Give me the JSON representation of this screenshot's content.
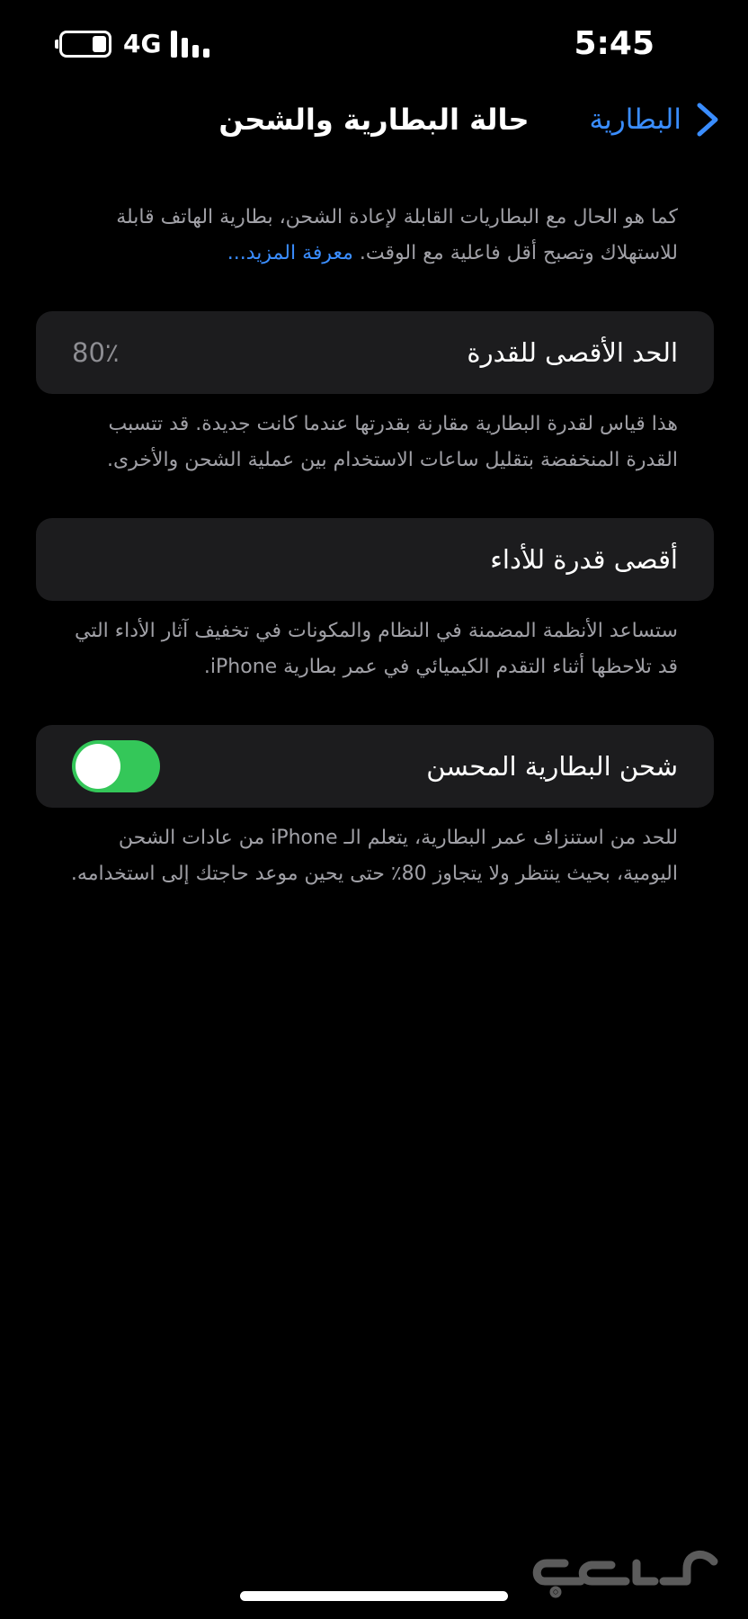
{
  "status_bar": {
    "network": "4G",
    "time": "5:45"
  },
  "nav": {
    "back_label": "البطارية",
    "title": "حالة البطارية والشحن"
  },
  "intro": {
    "text": "كما هو الحال مع البطاريات القابلة لإعادة الشحن، بطارية الهاتف قابلة للاستهلاك وتصبح أقل فاعلية مع الوقت. ",
    "link": "معرفة المزيد..."
  },
  "max_capacity": {
    "label": "الحد الأقصى للقدرة",
    "value": "80٪",
    "footer": "هذا قياس لقدرة البطارية مقارنة بقدرتها عندما كانت جديدة. قد تتسبب القدرة المنخفضة بتقليل ساعات الاستخدام بين عملية الشحن والأخرى."
  },
  "peak_performance": {
    "label": "أقصى قدرة للأداء",
    "footer": "ستساعد الأنظمة المضمنة في النظام والمكونات في تخفيف آثار الأداء التي قد تلاحظها أثناء التقدم الكيميائي في عمر بطارية iPhone."
  },
  "optimized_charging": {
    "label": "شحن البطارية المحسن",
    "enabled": true,
    "footer": "للحد من استنزاف عمر البطارية، يتعلم الـ iPhone من عادات الشحن اليومية، بحيث ينتظر ولا يتجاوز 80٪ حتى يحين موعد حاجتك إلى استخدامه."
  },
  "watermark": "حراج",
  "colors": {
    "accent": "#3a8dff",
    "toggle_on": "#34c759",
    "cell_bg": "#1c1c1e",
    "secondary_text": "#a0a0a6"
  }
}
